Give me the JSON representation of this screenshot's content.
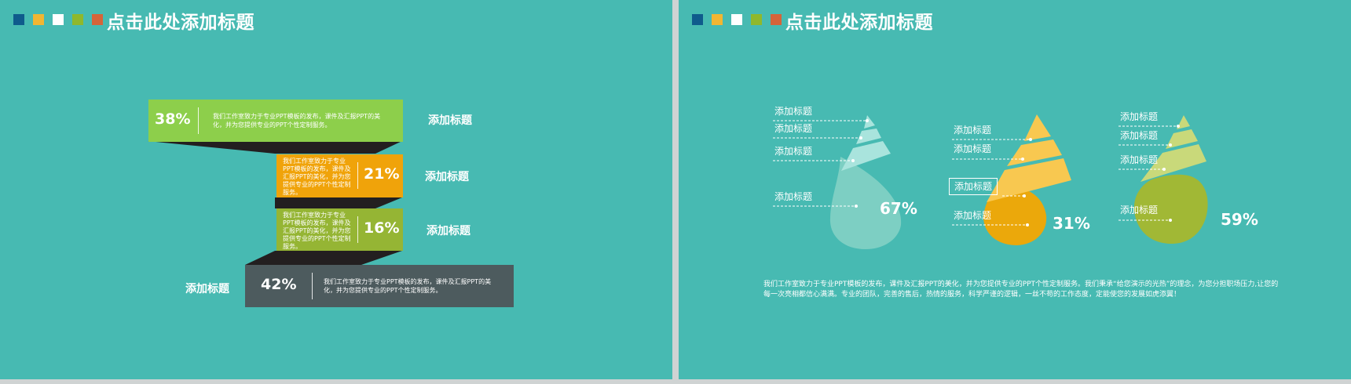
{
  "slide1": {
    "title": "点击此处添加标题",
    "square_colors": [
      "#0f5b8c",
      "#f2b632",
      "#ffffff",
      "#8fb82c",
      "#d5643a"
    ],
    "bands": [
      {
        "pct": "38%",
        "desc": "我们工作室致力于专业PPT模板的发布，课件及汇报PPT的美化，并为您提供专业的PPT个性定制服务。",
        "title": "添加标题",
        "color": "#8dcf4b"
      },
      {
        "pct": "21%",
        "desc": "我们工作室致力于专业PPT模板的发布，课件及汇报PPT的美化，并为您提供专业的PPT个性定制服务。",
        "title": "添加标题",
        "color": "#f0a30a"
      },
      {
        "pct": "16%",
        "desc": "我们工作室致力于专业PPT模板的发布，课件及汇报PPT的美化，并为您提供专业的PPT个性定制服务。",
        "title": "添加标题",
        "color": "#95b534"
      },
      {
        "pct": "42%",
        "desc": "我们工作室致力于专业PPT模板的发布，课件及汇报PPT的美化，并为您提供专业的PPT个性定制服务。",
        "title": "添加标题",
        "color": "#4d5b5e"
      }
    ],
    "shadow_color": "#231f20"
  },
  "slide2": {
    "title": "点击此处添加标题",
    "square_colors": [
      "#0f5b8c",
      "#f2b632",
      "#ffffff",
      "#8fb82c",
      "#d5643a"
    ],
    "drops": [
      {
        "pct": "67%",
        "labels": [
          "添加标题",
          "添加标题",
          "添加标题",
          "添加标题"
        ],
        "color": "#7dcfc3",
        "light": "#a9e4dd"
      },
      {
        "pct": "31%",
        "labels": [
          "添加标题",
          "添加标题",
          "添加标题",
          "添加标题"
        ],
        "color": "#eba80b",
        "light": "#f8c850"
      },
      {
        "pct": "59%",
        "labels": [
          "添加标题",
          "添加标题",
          "添加标题",
          "添加标题"
        ],
        "color": "#a1b835",
        "light": "#c9d97a"
      }
    ],
    "body": "我们工作室致力于专业PPT模板的发布，课件及汇报PPT的美化，并为您提供专业的PPT个性定制服务。我们秉承“给您演示的光热”的理念，为您分担职场压力,让您的每一次亮相都信心满满。专业的团队，完善的售后，热情的服务，科学严谨的逻辑，一丝不苟的工作态度，定能使您的发展如虎添翼！"
  }
}
